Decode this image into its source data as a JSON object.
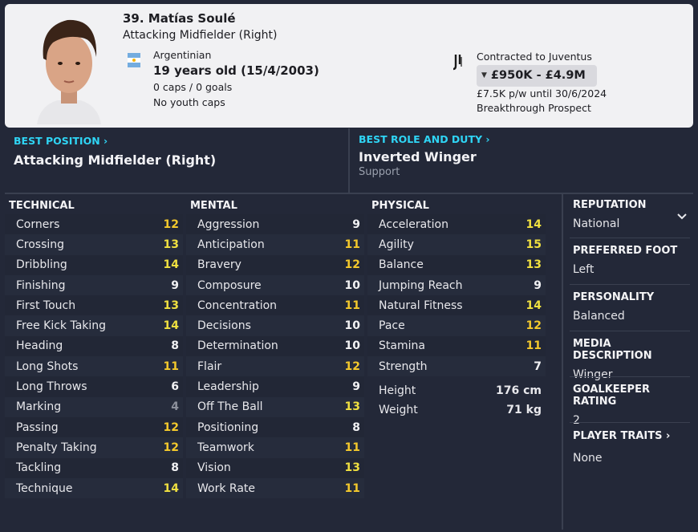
{
  "player": {
    "name": "39. Matías Soulé",
    "position": "Attacking Midfielder (Right)",
    "nationality": "Argentinian",
    "age": "19 years old (15/4/2003)",
    "caps": "0 caps / 0 goals",
    "youth_caps": "No youth caps",
    "contract": "Contracted to Juventus",
    "value": "£950K - £4.9M",
    "wage": "£7.5K p/w until 30/6/2024",
    "status": "Breakthrough Prospect"
  },
  "best_position": {
    "heading": "BEST POSITION",
    "value": "Attacking Midfielder (Right)"
  },
  "best_role": {
    "heading": "BEST ROLE AND DUTY",
    "value": "Inverted Winger",
    "duty": "Support"
  },
  "technical": {
    "title": "TECHNICAL",
    "attributes": [
      {
        "label": "Corners",
        "value": "12"
      },
      {
        "label": "Crossing",
        "value": "13"
      },
      {
        "label": "Dribbling",
        "value": "14"
      },
      {
        "label": "Finishing",
        "value": "9"
      },
      {
        "label": "First Touch",
        "value": "13"
      },
      {
        "label": "Free Kick Taking",
        "value": "14"
      },
      {
        "label": "Heading",
        "value": "8"
      },
      {
        "label": "Long Shots",
        "value": "11"
      },
      {
        "label": "Long Throws",
        "value": "6"
      },
      {
        "label": "Marking",
        "value": "4"
      },
      {
        "label": "Passing",
        "value": "12"
      },
      {
        "label": "Penalty Taking",
        "value": "12"
      },
      {
        "label": "Tackling",
        "value": "8"
      },
      {
        "label": "Technique",
        "value": "14"
      }
    ]
  },
  "mental": {
    "title": "MENTAL",
    "attributes": [
      {
        "label": "Aggression",
        "value": "9"
      },
      {
        "label": "Anticipation",
        "value": "11"
      },
      {
        "label": "Bravery",
        "value": "12"
      },
      {
        "label": "Composure",
        "value": "10"
      },
      {
        "label": "Concentration",
        "value": "11"
      },
      {
        "label": "Decisions",
        "value": "10"
      },
      {
        "label": "Determination",
        "value": "10"
      },
      {
        "label": "Flair",
        "value": "12"
      },
      {
        "label": "Leadership",
        "value": "9"
      },
      {
        "label": "Off The Ball",
        "value": "13"
      },
      {
        "label": "Positioning",
        "value": "8"
      },
      {
        "label": "Teamwork",
        "value": "11"
      },
      {
        "label": "Vision",
        "value": "13"
      },
      {
        "label": "Work Rate",
        "value": "11"
      }
    ]
  },
  "physical": {
    "title": "PHYSICAL",
    "attributes": [
      {
        "label": "Acceleration",
        "value": "14"
      },
      {
        "label": "Agility",
        "value": "15"
      },
      {
        "label": "Balance",
        "value": "13"
      },
      {
        "label": "Jumping Reach",
        "value": "9"
      },
      {
        "label": "Natural Fitness",
        "value": "14"
      },
      {
        "label": "Pace",
        "value": "12"
      },
      {
        "label": "Stamina",
        "value": "11"
      },
      {
        "label": "Strength",
        "value": "7"
      }
    ],
    "height_label": "Height",
    "height": "176 cm",
    "weight_label": "Weight",
    "weight": "71 kg"
  },
  "info_panel": {
    "reputation_label": "REPUTATION",
    "reputation": "National",
    "foot_label": "PREFERRED FOOT",
    "foot": "Left",
    "personality_label": "PERSONALITY",
    "personality": "Balanced",
    "media_label": "MEDIA DESCRIPTION",
    "media": "Winger",
    "gk_label": "GOALKEEPER RATING",
    "gk": "2",
    "traits_label": "PLAYER TRAITS",
    "traits": "None"
  },
  "colors": {
    "accent": "#2fd5f5",
    "background": "#232838",
    "attr_high": "#f0e040",
    "attr_low": "#8c909c"
  }
}
